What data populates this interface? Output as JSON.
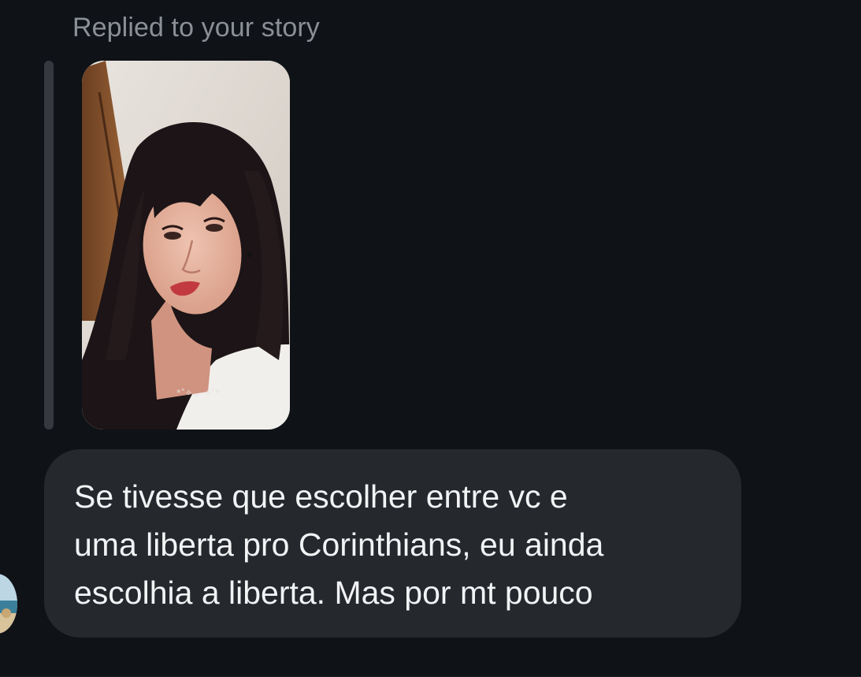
{
  "reply": {
    "caption": "Replied to your story"
  },
  "story": {
    "thumbnail_icon": "story-photo-thumbnail",
    "sticker_text": "*˚✧.。✧˚*"
  },
  "message": {
    "text": "Se tivesse que escolher entre vc e\numa liberta pro Corinthians, eu ainda\nescolhia a liberta. Mas por mt pouco"
  },
  "colors": {
    "background": "#0f1216",
    "bubble": "#25282d",
    "caption": "#8b8f96",
    "reply_bar": "#35383e",
    "text": "#f2f3f5"
  }
}
